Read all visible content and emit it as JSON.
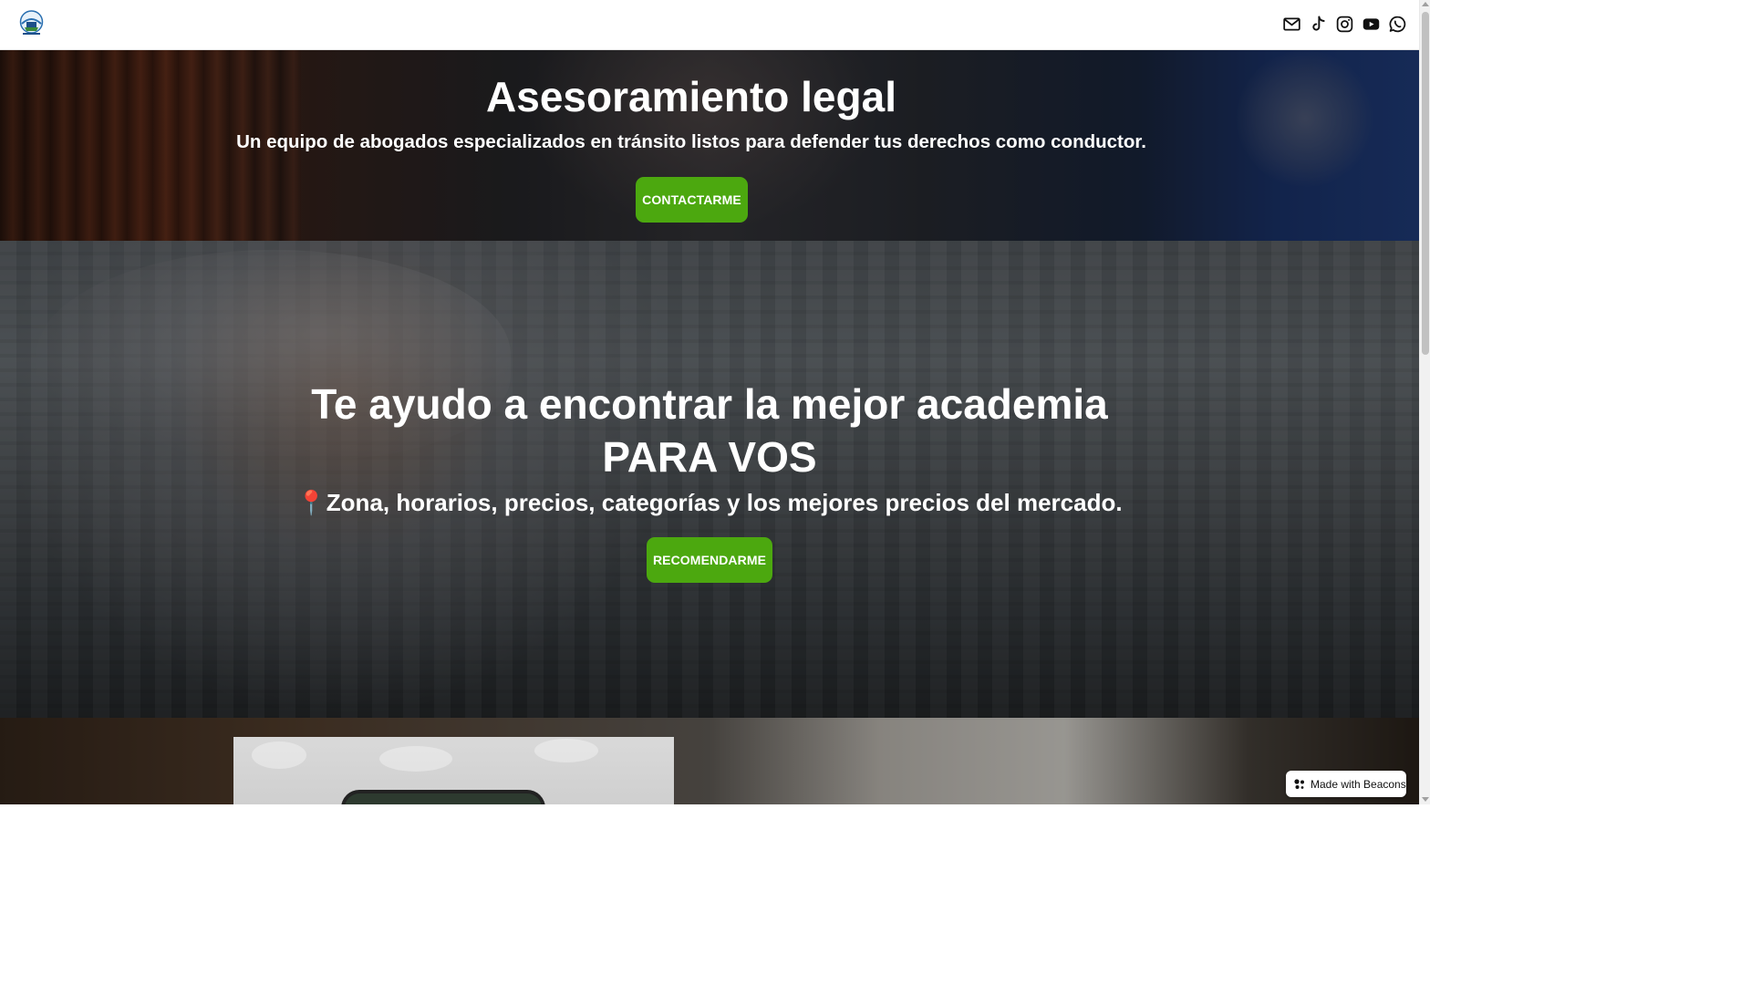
{
  "header": {
    "logo_name": "transito-logo",
    "socials": [
      {
        "name": "email-icon"
      },
      {
        "name": "tiktok-icon"
      },
      {
        "name": "instagram-icon"
      },
      {
        "name": "youtube-icon"
      },
      {
        "name": "whatsapp-icon"
      }
    ]
  },
  "hero1": {
    "title": "Asesoramiento legal",
    "subtitle": "Un equipo de abogados especializados en tránsito listos para defender tus derechos como conductor.",
    "button_label": "CONTACTARME"
  },
  "hero2": {
    "title": "Te ayudo a encontrar la mejor academia PARA VOS",
    "subtitle": "📍Zona, horarios, precios, categorías y los mejores precios del mercado.",
    "button_label": "RECOMENDARME"
  },
  "footer_badge": {
    "label": "Made with Beacons"
  },
  "colors": {
    "accent_button": "#4ca80f",
    "text_on_hero": "#ffffff"
  }
}
